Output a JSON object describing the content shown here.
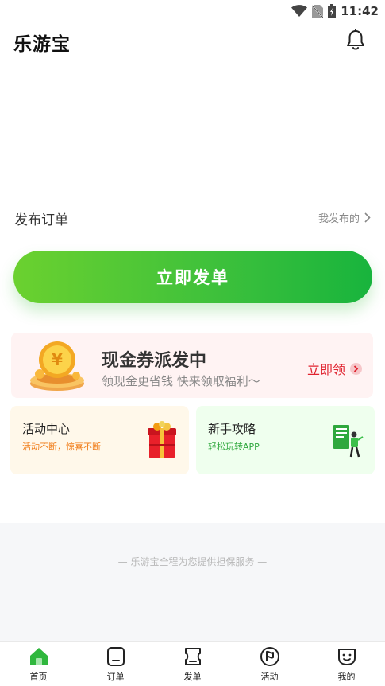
{
  "status_bar": {
    "time": "11:42"
  },
  "header": {
    "title": "乐游宝"
  },
  "publish_section": {
    "title": "发布订单",
    "my_published_label": "我发布的",
    "publish_button_label": "立即发单"
  },
  "coupon": {
    "title": "现金券派发中",
    "subtitle": "领现金更省钱 快来领取福利～",
    "cta_label": "立即领"
  },
  "cards": {
    "activity": {
      "title": "活动中心",
      "subtitle": "活动不断，惊喜不断"
    },
    "guide": {
      "title": "新手攻略",
      "subtitle": "轻松玩转APP"
    }
  },
  "footer": {
    "guarantee_text": "— 乐游宝全程为您提供担保服务 —"
  },
  "tabbar": {
    "tabs": [
      {
        "label": "首页",
        "icon": "home-icon",
        "active": true
      },
      {
        "label": "订单",
        "icon": "orders-icon",
        "active": false
      },
      {
        "label": "发单",
        "icon": "publish-icon",
        "active": false
      },
      {
        "label": "活动",
        "icon": "activity-icon",
        "active": false
      },
      {
        "label": "我的",
        "icon": "profile-icon",
        "active": false
      }
    ]
  },
  "colors": {
    "accent_green": "#27b43d",
    "coupon_red": "#e0232f",
    "activity_orange": "#f07b16"
  }
}
